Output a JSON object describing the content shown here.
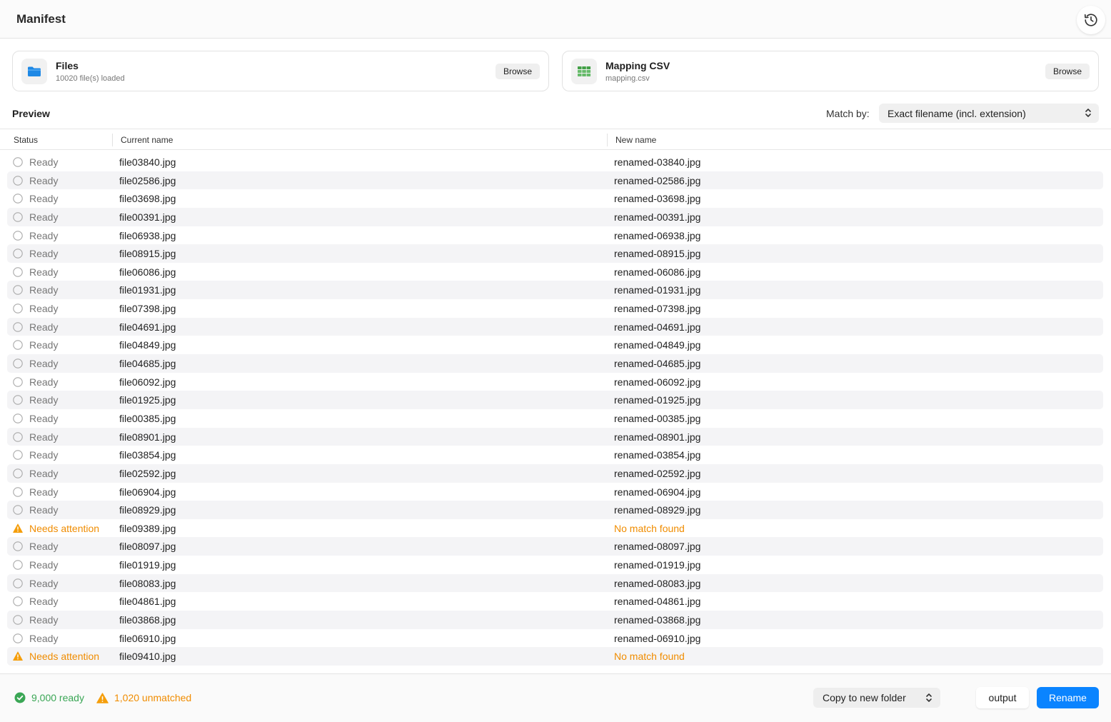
{
  "app": {
    "title": "Manifest"
  },
  "sources": {
    "files": {
      "title": "Files",
      "subtitle": "10020 file(s) loaded",
      "browse_label": "Browse",
      "icon": "folder-icon"
    },
    "mapping": {
      "title": "Mapping CSV",
      "subtitle": "mapping.csv",
      "browse_label": "Browse",
      "icon": "spreadsheet-icon"
    }
  },
  "preview": {
    "label": "Preview",
    "match_label": "Match by:",
    "match_value": "Exact filename (incl. extension)"
  },
  "table": {
    "columns": [
      "Status",
      "Current name",
      "New name"
    ],
    "rows": [
      {
        "status": "Ready",
        "current": "file03840.jpg",
        "new": "renamed-03840.jpg"
      },
      {
        "status": "Ready",
        "current": "file02586.jpg",
        "new": "renamed-02586.jpg"
      },
      {
        "status": "Ready",
        "current": "file03698.jpg",
        "new": "renamed-03698.jpg"
      },
      {
        "status": "Ready",
        "current": "file00391.jpg",
        "new": "renamed-00391.jpg"
      },
      {
        "status": "Ready",
        "current": "file06938.jpg",
        "new": "renamed-06938.jpg"
      },
      {
        "status": "Ready",
        "current": "file08915.jpg",
        "new": "renamed-08915.jpg"
      },
      {
        "status": "Ready",
        "current": "file06086.jpg",
        "new": "renamed-06086.jpg"
      },
      {
        "status": "Ready",
        "current": "file01931.jpg",
        "new": "renamed-01931.jpg"
      },
      {
        "status": "Ready",
        "current": "file07398.jpg",
        "new": "renamed-07398.jpg"
      },
      {
        "status": "Ready",
        "current": "file04691.jpg",
        "new": "renamed-04691.jpg"
      },
      {
        "status": "Ready",
        "current": "file04849.jpg",
        "new": "renamed-04849.jpg"
      },
      {
        "status": "Ready",
        "current": "file04685.jpg",
        "new": "renamed-04685.jpg"
      },
      {
        "status": "Ready",
        "current": "file06092.jpg",
        "new": "renamed-06092.jpg"
      },
      {
        "status": "Ready",
        "current": "file01925.jpg",
        "new": "renamed-01925.jpg"
      },
      {
        "status": "Ready",
        "current": "file00385.jpg",
        "new": "renamed-00385.jpg"
      },
      {
        "status": "Ready",
        "current": "file08901.jpg",
        "new": "renamed-08901.jpg"
      },
      {
        "status": "Ready",
        "current": "file03854.jpg",
        "new": "renamed-03854.jpg"
      },
      {
        "status": "Ready",
        "current": "file02592.jpg",
        "new": "renamed-02592.jpg"
      },
      {
        "status": "Ready",
        "current": "file06904.jpg",
        "new": "renamed-06904.jpg"
      },
      {
        "status": "Ready",
        "current": "file08929.jpg",
        "new": "renamed-08929.jpg"
      },
      {
        "status": "Needs attention",
        "current": "file09389.jpg",
        "new": "No match found"
      },
      {
        "status": "Ready",
        "current": "file08097.jpg",
        "new": "renamed-08097.jpg"
      },
      {
        "status": "Ready",
        "current": "file01919.jpg",
        "new": "renamed-01919.jpg"
      },
      {
        "status": "Ready",
        "current": "file08083.jpg",
        "new": "renamed-08083.jpg"
      },
      {
        "status": "Ready",
        "current": "file04861.jpg",
        "new": "renamed-04861.jpg"
      },
      {
        "status": "Ready",
        "current": "file03868.jpg",
        "new": "renamed-03868.jpg"
      },
      {
        "status": "Ready",
        "current": "file06910.jpg",
        "new": "renamed-06910.jpg"
      },
      {
        "status": "Needs attention",
        "current": "file09410.jpg",
        "new": "No match found"
      }
    ]
  },
  "footer": {
    "ready_summary": "9,000 ready",
    "unmatched_summary": "1,020 unmatched",
    "mode_value": "Copy to new folder",
    "output_label": "output",
    "rename_label": "Rename"
  },
  "colors": {
    "accent": "#0a84ff",
    "ready_green": "#3aa655",
    "warning_orange": "#f08c00",
    "muted_text": "#777777",
    "row_stripe": "#f4f4f6"
  }
}
